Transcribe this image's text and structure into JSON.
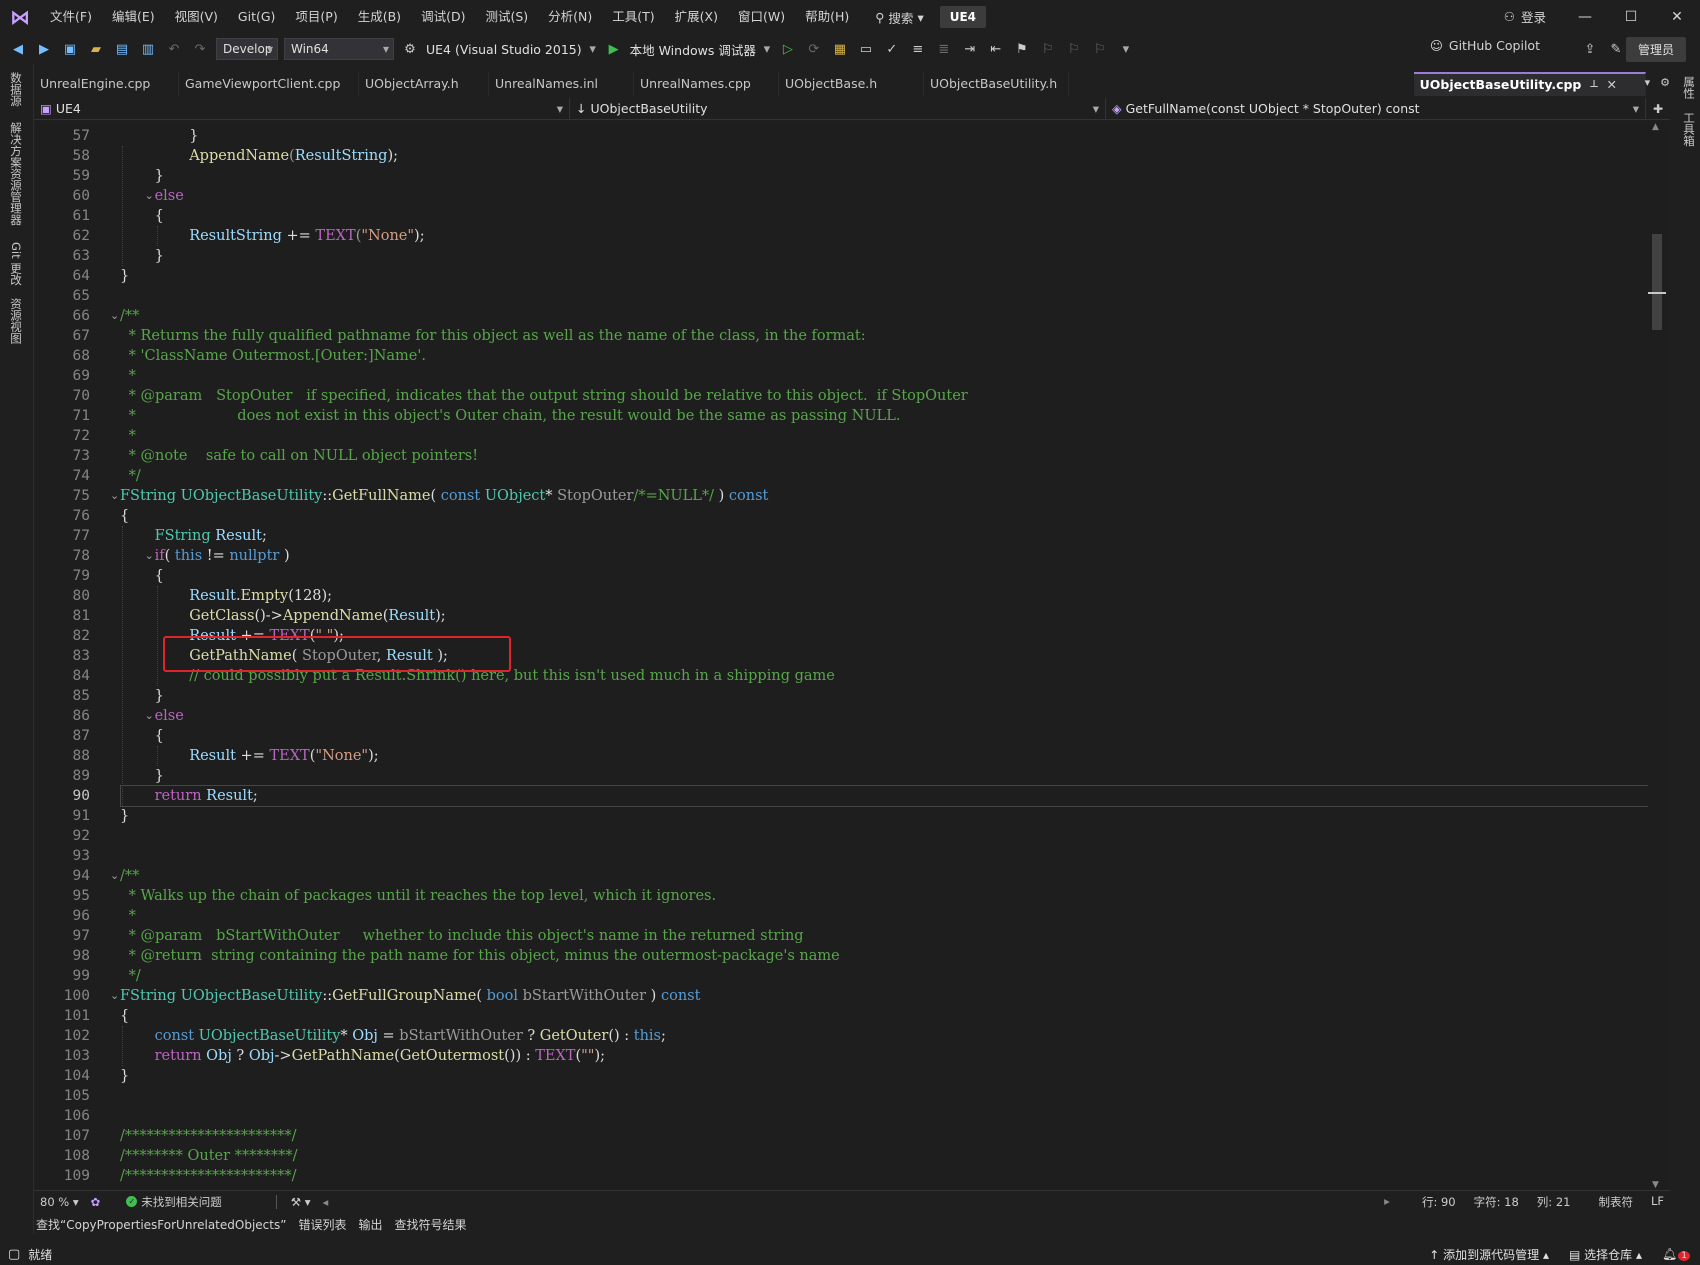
{
  "menubar": {
    "items": [
      "文件(F)",
      "编辑(E)",
      "视图(V)",
      "Git(G)",
      "项目(P)",
      "生成(B)",
      "调试(D)",
      "测试(S)",
      "分析(N)",
      "工具(T)",
      "扩展(X)",
      "窗口(W)",
      "帮助(H)"
    ],
    "search_label": "搜索",
    "solution_name": "UE4",
    "login_label": "登录"
  },
  "toolbar": {
    "config": "Develop",
    "platform": "Win64",
    "project": "UE4 (Visual Studio 2015)",
    "debugger": "本地 Windows 调试器",
    "copilot": "GitHub Copilot",
    "admin": "管理员"
  },
  "left_strip": [
    "数据源",
    "解决方案资源管理器",
    "Git 更改",
    "资源视图"
  ],
  "right_strip": [
    "属性",
    "工具箱"
  ],
  "tabs": [
    "UnrealEngine.cpp",
    "GameViewportClient.cpp",
    "UObjectArray.h",
    "UnrealNames.inl",
    "UnrealNames.cpp",
    "UObjectBase.h",
    "UObjectBaseUtility.h"
  ],
  "active_tab": "UObjectBaseUtility.cpp",
  "navbar": {
    "project": "UE4",
    "scope": "UObjectBaseUtility",
    "member": "GetFullName(const UObject * StopOuter) const"
  },
  "editor": {
    "current_line": 90,
    "lines": [
      {
        "n": 57,
        "indent": 8,
        "fold": false,
        "tokens": [
          [
            "}",
            ""
          ]
        ]
      },
      {
        "n": 58,
        "indent": 8,
        "fold": false,
        "tokens": [
          [
            "AppendName",
            "fn"
          ],
          [
            "(",
            "par"
          ],
          [
            "ResultString",
            "var"
          ],
          [
            ");",
            ""
          ]
        ]
      },
      {
        "n": 59,
        "indent": 4,
        "fold": false,
        "tokens": [
          [
            "}",
            ""
          ]
        ]
      },
      {
        "n": 60,
        "indent": 4,
        "fold": true,
        "tokens": [
          [
            "else",
            "mac"
          ]
        ]
      },
      {
        "n": 61,
        "indent": 4,
        "fold": false,
        "tokens": [
          [
            "{",
            ""
          ]
        ]
      },
      {
        "n": 62,
        "indent": 8,
        "fold": false,
        "tokens": [
          [
            "ResultString",
            "var"
          ],
          [
            " += ",
            ""
          ],
          [
            "TEXT",
            "mac"
          ],
          [
            "(",
            "par"
          ],
          [
            "\"None\"",
            "str"
          ],
          [
            ");",
            ""
          ]
        ]
      },
      {
        "n": 63,
        "indent": 4,
        "fold": false,
        "tokens": [
          [
            "}",
            ""
          ]
        ]
      },
      {
        "n": 64,
        "indent": 0,
        "fold": false,
        "tokens": [
          [
            "}",
            ""
          ]
        ]
      },
      {
        "n": 65,
        "indent": 0,
        "fold": false,
        "tokens": []
      },
      {
        "n": 66,
        "indent": 0,
        "fold": true,
        "tokens": [
          [
            "/**",
            "cm"
          ]
        ]
      },
      {
        "n": 67,
        "indent": 1,
        "fold": false,
        "tokens": [
          [
            "* Returns the fully qualified pathname for this object as well as the name of the class, in the format:",
            "cm"
          ]
        ]
      },
      {
        "n": 68,
        "indent": 1,
        "fold": false,
        "tokens": [
          [
            "* 'ClassName Outermost.[Outer:]Name'.",
            "cm"
          ]
        ]
      },
      {
        "n": 69,
        "indent": 1,
        "fold": false,
        "tokens": [
          [
            "*",
            "cm"
          ]
        ]
      },
      {
        "n": 70,
        "indent": 1,
        "fold": false,
        "tokens": [
          [
            "* @param   StopOuter   if specified, indicates that the output string should be relative to this object.  if StopOuter",
            "cm"
          ]
        ]
      },
      {
        "n": 71,
        "indent": 1,
        "fold": false,
        "tokens": [
          [
            "*                      does not exist in this object's Outer chain, the result would be the same as passing NULL.",
            "cm"
          ]
        ]
      },
      {
        "n": 72,
        "indent": 1,
        "fold": false,
        "tokens": [
          [
            "*",
            "cm"
          ]
        ]
      },
      {
        "n": 73,
        "indent": 1,
        "fold": false,
        "tokens": [
          [
            "* @note    safe to call on NULL object pointers!",
            "cm"
          ]
        ]
      },
      {
        "n": 74,
        "indent": 1,
        "fold": false,
        "tokens": [
          [
            "*/",
            "cm"
          ]
        ]
      },
      {
        "n": 75,
        "indent": 0,
        "fold": true,
        "tokens": [
          [
            "FString",
            "ty"
          ],
          [
            " ",
            ""
          ],
          [
            "UObjectBaseUtility",
            "ty"
          ],
          [
            "::",
            ""
          ],
          [
            "GetFullName",
            "fn"
          ],
          [
            "( ",
            ""
          ],
          [
            "const",
            "kw"
          ],
          [
            " ",
            ""
          ],
          [
            "UObject",
            "ty"
          ],
          [
            "* ",
            ""
          ],
          [
            "StopOuter",
            "par"
          ],
          [
            "/*=NULL*/",
            "cm"
          ],
          [
            " ) ",
            ""
          ],
          [
            "const",
            "kw"
          ]
        ]
      },
      {
        "n": 76,
        "indent": 0,
        "fold": false,
        "tokens": [
          [
            "{",
            ""
          ]
        ]
      },
      {
        "n": 77,
        "indent": 4,
        "fold": false,
        "tokens": [
          [
            "FString",
            "ty"
          ],
          [
            " ",
            ""
          ],
          [
            "Result",
            "var"
          ],
          [
            ";",
            ""
          ]
        ]
      },
      {
        "n": 78,
        "indent": 4,
        "fold": true,
        "tokens": [
          [
            "if",
            "mac"
          ],
          [
            "( ",
            ""
          ],
          [
            "this",
            "kw"
          ],
          [
            " != ",
            ""
          ],
          [
            "nullptr",
            "kw"
          ],
          [
            " )",
            ""
          ]
        ]
      },
      {
        "n": 79,
        "indent": 4,
        "fold": false,
        "tokens": [
          [
            "{",
            ""
          ]
        ]
      },
      {
        "n": 80,
        "indent": 8,
        "fold": false,
        "tokens": [
          [
            "Result",
            "var"
          ],
          [
            ".",
            ""
          ],
          [
            "Empty",
            "fn"
          ],
          [
            "(128);",
            ""
          ]
        ]
      },
      {
        "n": 81,
        "indent": 8,
        "fold": false,
        "tokens": [
          [
            "GetClass",
            "fn"
          ],
          [
            "()->",
            ""
          ],
          [
            "AppendName",
            "fn"
          ],
          [
            "(",
            ""
          ],
          [
            "Result",
            "var"
          ],
          [
            ");",
            ""
          ]
        ]
      },
      {
        "n": 82,
        "indent": 8,
        "fold": false,
        "tokens": [
          [
            "Result",
            "var"
          ],
          [
            " += ",
            ""
          ],
          [
            "TEXT",
            "mac"
          ],
          [
            "(",
            ""
          ],
          [
            "\" \"",
            "str"
          ],
          [
            ");",
            ""
          ]
        ]
      },
      {
        "n": 83,
        "indent": 8,
        "fold": false,
        "tokens": [
          [
            "GetPathName",
            "fn"
          ],
          [
            "( ",
            ""
          ],
          [
            "StopOuter",
            "par"
          ],
          [
            ", ",
            ""
          ],
          [
            "Result",
            "var"
          ],
          [
            " );",
            ""
          ]
        ]
      },
      {
        "n": 84,
        "indent": 8,
        "fold": false,
        "tokens": [
          [
            "// could possibly put a Result.Shrink() here, but this isn't used much in a shipping game",
            "cm"
          ]
        ]
      },
      {
        "n": 85,
        "indent": 4,
        "fold": false,
        "tokens": [
          [
            "}",
            ""
          ]
        ]
      },
      {
        "n": 86,
        "indent": 4,
        "fold": true,
        "tokens": [
          [
            "else",
            "mac"
          ]
        ]
      },
      {
        "n": 87,
        "indent": 4,
        "fold": false,
        "tokens": [
          [
            "{",
            ""
          ]
        ]
      },
      {
        "n": 88,
        "indent": 8,
        "fold": false,
        "tokens": [
          [
            "Result",
            "var"
          ],
          [
            " += ",
            ""
          ],
          [
            "TEXT",
            "mac"
          ],
          [
            "(",
            ""
          ],
          [
            "\"None\"",
            "str"
          ],
          [
            ");",
            ""
          ]
        ]
      },
      {
        "n": 89,
        "indent": 4,
        "fold": false,
        "tokens": [
          [
            "}",
            ""
          ]
        ]
      },
      {
        "n": 90,
        "indent": 4,
        "fold": false,
        "tokens": [
          [
            "return",
            "mac"
          ],
          [
            " ",
            ""
          ],
          [
            "Result",
            "var"
          ],
          [
            ";",
            ""
          ]
        ]
      },
      {
        "n": 91,
        "indent": 0,
        "fold": false,
        "tokens": [
          [
            "}",
            ""
          ]
        ]
      },
      {
        "n": 92,
        "indent": 0,
        "fold": false,
        "tokens": []
      },
      {
        "n": 93,
        "indent": 0,
        "fold": false,
        "tokens": []
      },
      {
        "n": 94,
        "indent": 0,
        "fold": true,
        "tokens": [
          [
            "/**",
            "cm"
          ]
        ]
      },
      {
        "n": 95,
        "indent": 1,
        "fold": false,
        "tokens": [
          [
            "* Walks up the chain of packages until it reaches the top level, which it ignores.",
            "cm"
          ]
        ]
      },
      {
        "n": 96,
        "indent": 1,
        "fold": false,
        "tokens": [
          [
            "*",
            "cm"
          ]
        ]
      },
      {
        "n": 97,
        "indent": 1,
        "fold": false,
        "tokens": [
          [
            "* @param   bStartWithOuter     whether to include this object's name in the returned string",
            "cm"
          ]
        ]
      },
      {
        "n": 98,
        "indent": 1,
        "fold": false,
        "tokens": [
          [
            "* @return  string containing the path name for this object, minus the outermost-package's name",
            "cm"
          ]
        ]
      },
      {
        "n": 99,
        "indent": 1,
        "fold": false,
        "tokens": [
          [
            "*/",
            "cm"
          ]
        ]
      },
      {
        "n": 100,
        "indent": 0,
        "fold": true,
        "tokens": [
          [
            "FString",
            "ty"
          ],
          [
            " ",
            ""
          ],
          [
            "UObjectBaseUtility",
            "ty"
          ],
          [
            "::",
            ""
          ],
          [
            "GetFullGroupName",
            "fn"
          ],
          [
            "( ",
            ""
          ],
          [
            "bool",
            "kw"
          ],
          [
            " ",
            ""
          ],
          [
            "bStartWithOuter",
            "par"
          ],
          [
            " ) ",
            ""
          ],
          [
            "const",
            "kw"
          ]
        ]
      },
      {
        "n": 101,
        "indent": 0,
        "fold": false,
        "tokens": [
          [
            "{",
            ""
          ]
        ]
      },
      {
        "n": 102,
        "indent": 4,
        "fold": false,
        "tokens": [
          [
            "const",
            "kw"
          ],
          [
            " ",
            ""
          ],
          [
            "UObjectBaseUtility",
            "ty"
          ],
          [
            "* ",
            ""
          ],
          [
            "Obj",
            "var"
          ],
          [
            " = ",
            ""
          ],
          [
            "bStartWithOuter",
            "par"
          ],
          [
            " ? ",
            ""
          ],
          [
            "GetOuter",
            "fn"
          ],
          [
            "() : ",
            ""
          ],
          [
            "this",
            "kw"
          ],
          [
            ";",
            ""
          ]
        ]
      },
      {
        "n": 103,
        "indent": 4,
        "fold": false,
        "tokens": [
          [
            "return",
            "mac"
          ],
          [
            " ",
            ""
          ],
          [
            "Obj",
            "var"
          ],
          [
            " ? ",
            ""
          ],
          [
            "Obj",
            "var"
          ],
          [
            "->",
            ""
          ],
          [
            "GetPathName",
            "fn"
          ],
          [
            "(",
            ""
          ],
          [
            "GetOutermost",
            "fn"
          ],
          [
            "()) : ",
            ""
          ],
          [
            "TEXT",
            "mac"
          ],
          [
            "(",
            ""
          ],
          [
            "\"\"",
            "str"
          ],
          [
            ");",
            ""
          ]
        ]
      },
      {
        "n": 104,
        "indent": 0,
        "fold": false,
        "tokens": [
          [
            "}",
            ""
          ]
        ]
      },
      {
        "n": 105,
        "indent": 0,
        "fold": false,
        "tokens": []
      },
      {
        "n": 106,
        "indent": 0,
        "fold": false,
        "tokens": []
      },
      {
        "n": 107,
        "indent": 0,
        "fold": false,
        "tokens": [
          [
            "/***********************/",
            "cm"
          ]
        ]
      },
      {
        "n": 108,
        "indent": 0,
        "fold": false,
        "tokens": [
          [
            "/******** Outer ********/",
            "cm"
          ]
        ]
      },
      {
        "n": 109,
        "indent": 0,
        "fold": false,
        "tokens": [
          [
            "/***********************/",
            "cm"
          ]
        ]
      }
    ]
  },
  "status": {
    "zoom": "80 %",
    "issues": "未找到相关问题",
    "line": "行: 90",
    "char": "字符: 18",
    "col": "列: 21",
    "tabs": "制表符",
    "eol": "LF"
  },
  "output_tabs": [
    "查找“CopyPropertiesForUnrelatedObjects”",
    "错误列表",
    "输出",
    "查找符号结果"
  ],
  "bottombar": {
    "ready": "就绪",
    "source_control": "添加到源代码管理",
    "repo": "选择仓库",
    "notifications": "1"
  }
}
